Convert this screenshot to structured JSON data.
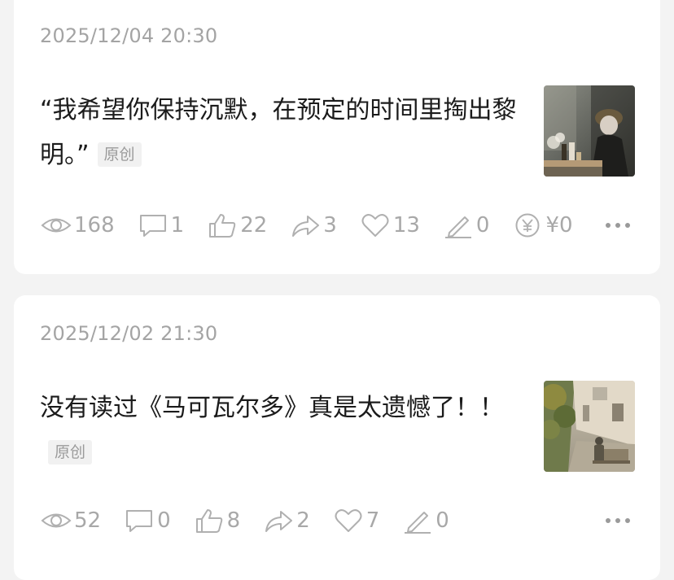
{
  "posts": [
    {
      "date": "2025/12/04 20:30",
      "title": "“我希望你保持沉默，在预定的时间里掏出黎明。”",
      "tag": "原创",
      "stats": {
        "views": "168",
        "comments": "1",
        "likes": "22",
        "shares": "3",
        "favorites": "13",
        "edits": "0",
        "tips": "¥0"
      }
    },
    {
      "date": "2025/12/02 21:30",
      "title": "没有读过《马可瓦尔多》真是太遗憾了！！",
      "tag": "原创",
      "stats": {
        "views": "52",
        "comments": "0",
        "likes": "8",
        "shares": "2",
        "favorites": "7",
        "edits": "0"
      }
    }
  ],
  "icons": {
    "views": "eye-icon",
    "comments": "comment-icon",
    "likes": "thumbs-up-icon",
    "shares": "share-arrow-icon",
    "favorites": "heart-icon",
    "edits": "pencil-icon",
    "tips": "yen-coin-icon",
    "more": "more-dots-icon"
  },
  "colors": {
    "background": "#f3f3f3",
    "card": "#ffffff",
    "title_text": "#1b1b1b",
    "meta_text": "#a8a8a8",
    "tag_bg": "#f1f1f1",
    "tag_text": "#9a9a9a"
  }
}
